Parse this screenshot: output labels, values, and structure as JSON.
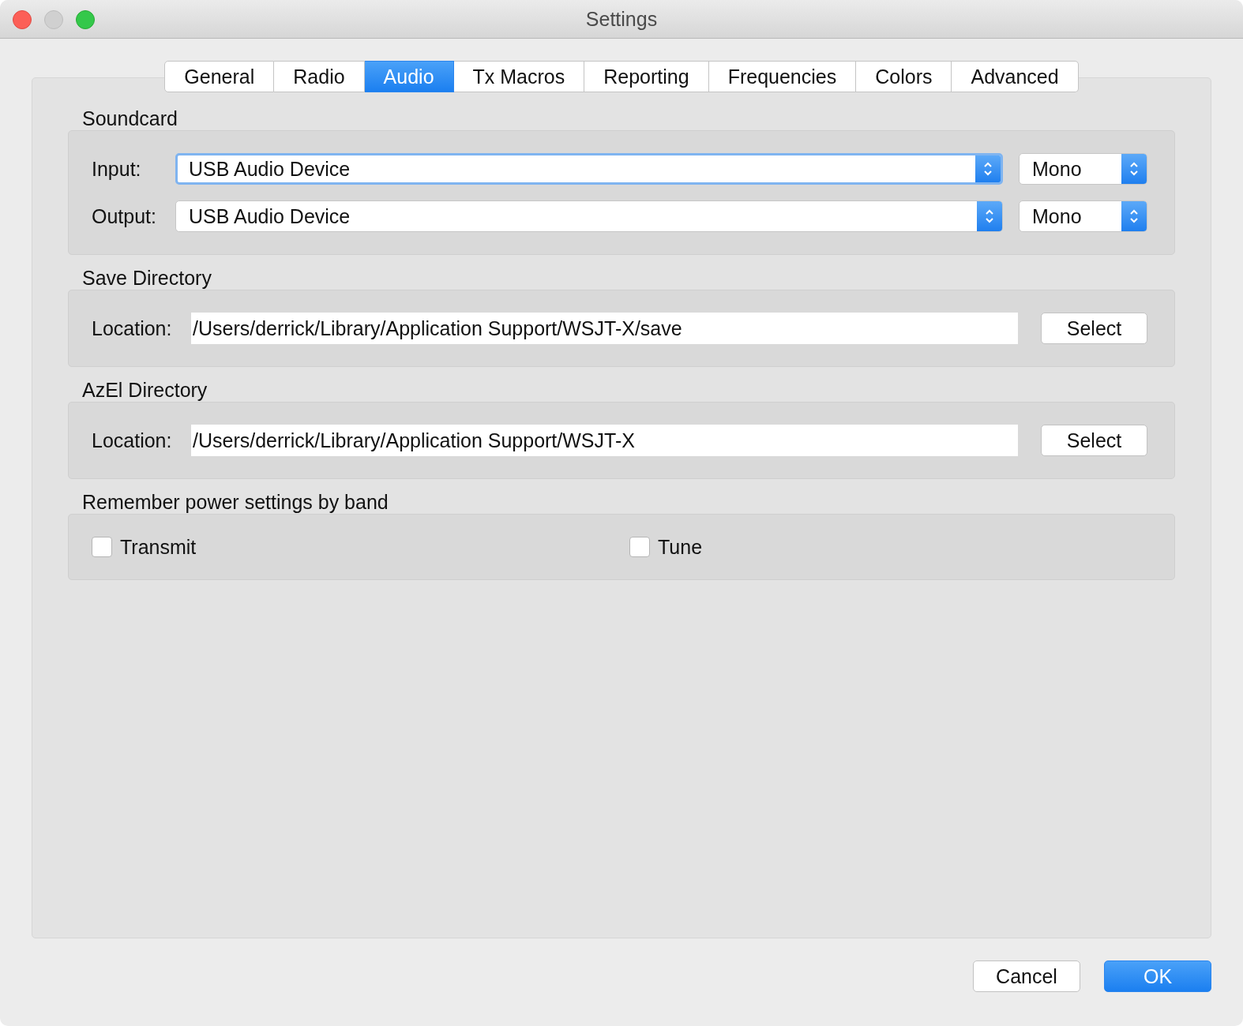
{
  "window": {
    "title": "Settings"
  },
  "tabs": [
    {
      "label": "General",
      "selected": false
    },
    {
      "label": "Radio",
      "selected": false
    },
    {
      "label": "Audio",
      "selected": true
    },
    {
      "label": "Tx Macros",
      "selected": false
    },
    {
      "label": "Reporting",
      "selected": false
    },
    {
      "label": "Frequencies",
      "selected": false
    },
    {
      "label": "Colors",
      "selected": false
    },
    {
      "label": "Advanced",
      "selected": false
    }
  ],
  "soundcard": {
    "title": "Soundcard",
    "rows": [
      {
        "label": "Input:",
        "device": "USB Audio Device",
        "channel": "Mono",
        "focused": true
      },
      {
        "label": "Output:",
        "device": "USB Audio Device",
        "channel": "Mono",
        "focused": false
      }
    ]
  },
  "directories": [
    {
      "title": "Save Directory",
      "label": "Location:",
      "value": "/Users/derrick/Library/Application Support/WSJT-X/save",
      "button": "Select"
    },
    {
      "title": "AzEl Directory",
      "label": "Location:",
      "value": "/Users/derrick/Library/Application Support/WSJT-X",
      "button": "Select"
    }
  ],
  "power": {
    "title": "Remember power settings by band",
    "options": [
      {
        "label": "Transmit",
        "checked": false
      },
      {
        "label": "Tune",
        "checked": false
      }
    ]
  },
  "buttons": [
    {
      "label": "Cancel",
      "kind": "secondary"
    },
    {
      "label": "OK",
      "kind": "default"
    }
  ]
}
